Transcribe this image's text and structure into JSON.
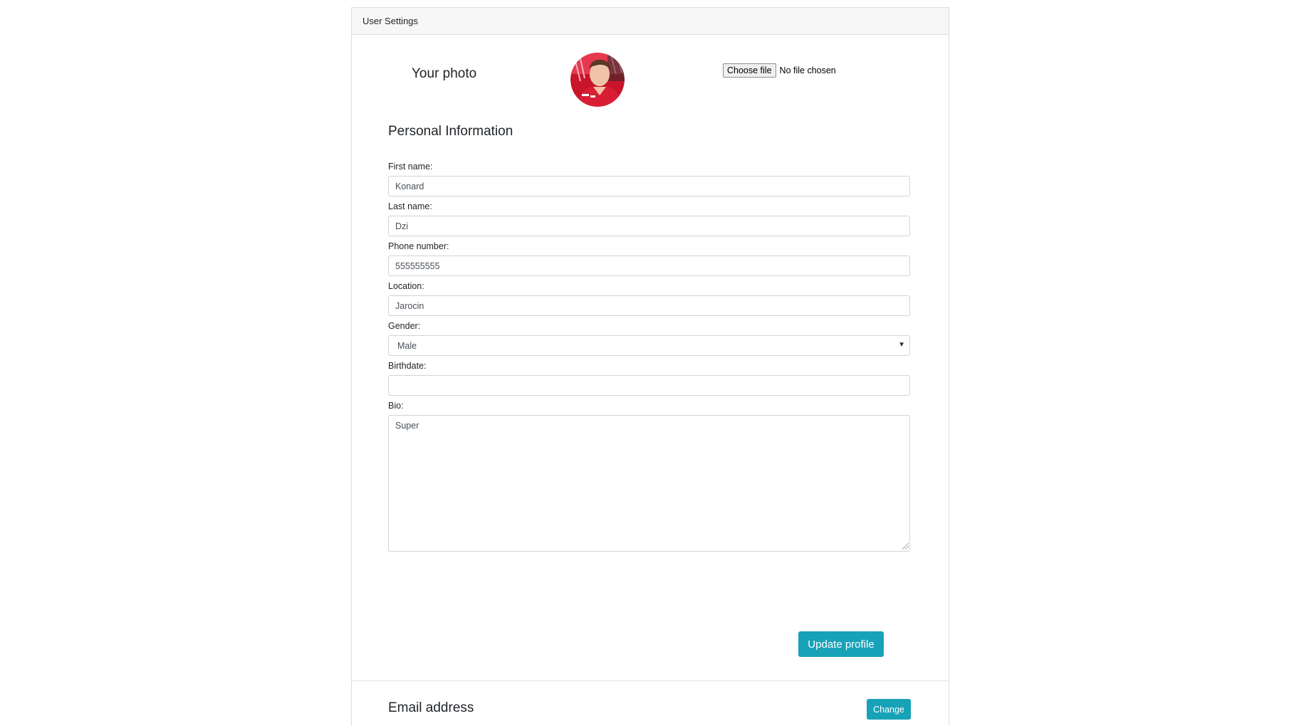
{
  "header": {
    "title": "User Settings"
  },
  "photo": {
    "label": "Your photo",
    "file_button": "Choose file",
    "file_status": "No file chosen"
  },
  "personal": {
    "title": "Personal Information",
    "first_name": {
      "label": "First name:",
      "value": "Konard"
    },
    "last_name": {
      "label": "Last name:",
      "value": "Dzi"
    },
    "phone": {
      "label": "Phone number:",
      "value": "555555555"
    },
    "location": {
      "label": "Location:",
      "value": "Jarocin"
    },
    "gender": {
      "label": "Gender:",
      "value": "Male"
    },
    "birthdate": {
      "label": "Birthdate:",
      "value": ""
    },
    "bio": {
      "label": "Bio:",
      "value": "Super"
    },
    "submit_label": "Update profile"
  },
  "email": {
    "title": "Email address",
    "change_label": "Change"
  },
  "colors": {
    "accent": "#17a2b8",
    "header_bg": "#f7f7f7",
    "border": "#ced4da"
  }
}
